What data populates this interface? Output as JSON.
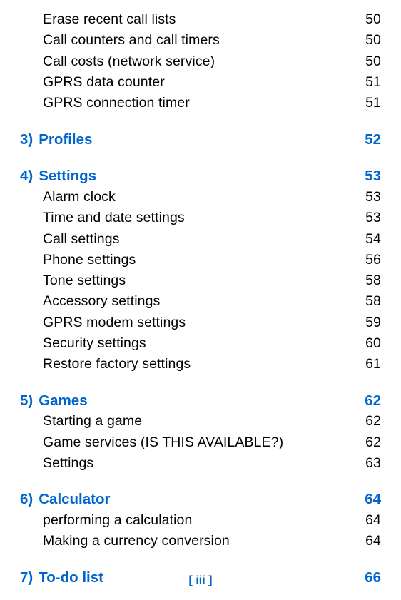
{
  "firstBlock": [
    {
      "label": "Erase recent call lists",
      "page": "50"
    },
    {
      "label": "Call counters and call timers",
      "page": "50"
    },
    {
      "label": "Call costs (network service)",
      "page": "50"
    },
    {
      "label": "GPRS data counter",
      "page": "51"
    },
    {
      "label": "GPRS connection timer",
      "page": "51"
    }
  ],
  "chapters": [
    {
      "num": "3)",
      "title": "Profiles",
      "page": "52",
      "subs": []
    },
    {
      "num": "4)",
      "title": "Settings",
      "page": "53",
      "subs": [
        {
          "label": "Alarm clock",
          "page": "53"
        },
        {
          "label": "Time and date settings",
          "page": "53"
        },
        {
          "label": "Call settings",
          "page": "54"
        },
        {
          "label": "Phone settings",
          "page": "56"
        },
        {
          "label": "Tone settings",
          "page": "58"
        },
        {
          "label": "Accessory settings",
          "page": "58"
        },
        {
          "label": "GPRS modem settings",
          "page": "59"
        },
        {
          "label": "Security settings",
          "page": "60"
        },
        {
          "label": "Restore factory settings",
          "page": "61"
        }
      ]
    },
    {
      "num": "5)",
      "title": "Games",
      "page": "62",
      "subs": [
        {
          "label": "Starting a game",
          "page": "62"
        },
        {
          "label": "Game services (IS THIS AVAILABLE?)",
          "page": "62"
        },
        {
          "label": "Settings",
          "page": "63"
        }
      ]
    },
    {
      "num": "6)",
      "title": "Calculator",
      "page": "64",
      "subs": [
        {
          "label": "performing a calculation",
          "page": "64"
        },
        {
          "label": "Making a currency conversion",
          "page": "64"
        }
      ]
    },
    {
      "num": "7)",
      "title": "To-do list",
      "page": "66",
      "subs": []
    }
  ],
  "footer": "[ iii ]"
}
